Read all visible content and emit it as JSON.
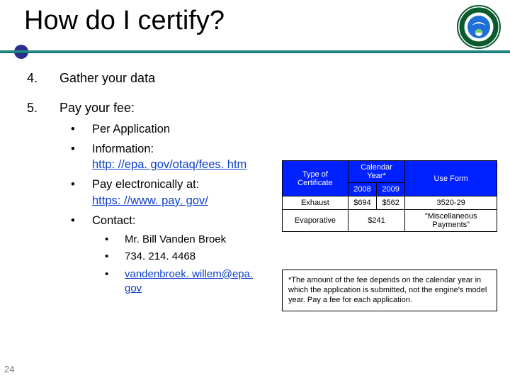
{
  "title": "How do I certify?",
  "page_number": "24",
  "steps": [
    {
      "num": "4.",
      "text": "Gather your data"
    },
    {
      "num": "5.",
      "text": "Pay your fee:"
    }
  ],
  "fee_items": {
    "per_app": "Per Application",
    "info_label": "Information:",
    "info_link": "http: //epa. gov/otaq/fees. htm",
    "pay_label": "Pay electronically at:",
    "pay_link": "https: //www. pay. gov/",
    "contact_label": "Contact:"
  },
  "contact": {
    "name": "Mr. Bill Vanden Broek",
    "phone": "734. 214. 4468",
    "email": "vandenbroek. willem@epa. gov"
  },
  "table": {
    "cal_title": "Calendar Year*",
    "headers": {
      "type": "Type of Certificate",
      "y1": "2008",
      "y2": "2009",
      "use": "Use Form"
    },
    "rows": [
      {
        "type": "Exhaust",
        "y1": "$694",
        "y2": "$562",
        "use": "3520-29"
      },
      {
        "type": "Evaporative",
        "merged_fee": "$241",
        "use": "\"Miscellaneous Payments\""
      }
    ]
  },
  "footnote": "*The amount of the fee depends on the calendar year in which the application is submitted, not the engine's model year.  Pay a fee for each application.",
  "logo": {
    "alt": "EPA seal"
  }
}
